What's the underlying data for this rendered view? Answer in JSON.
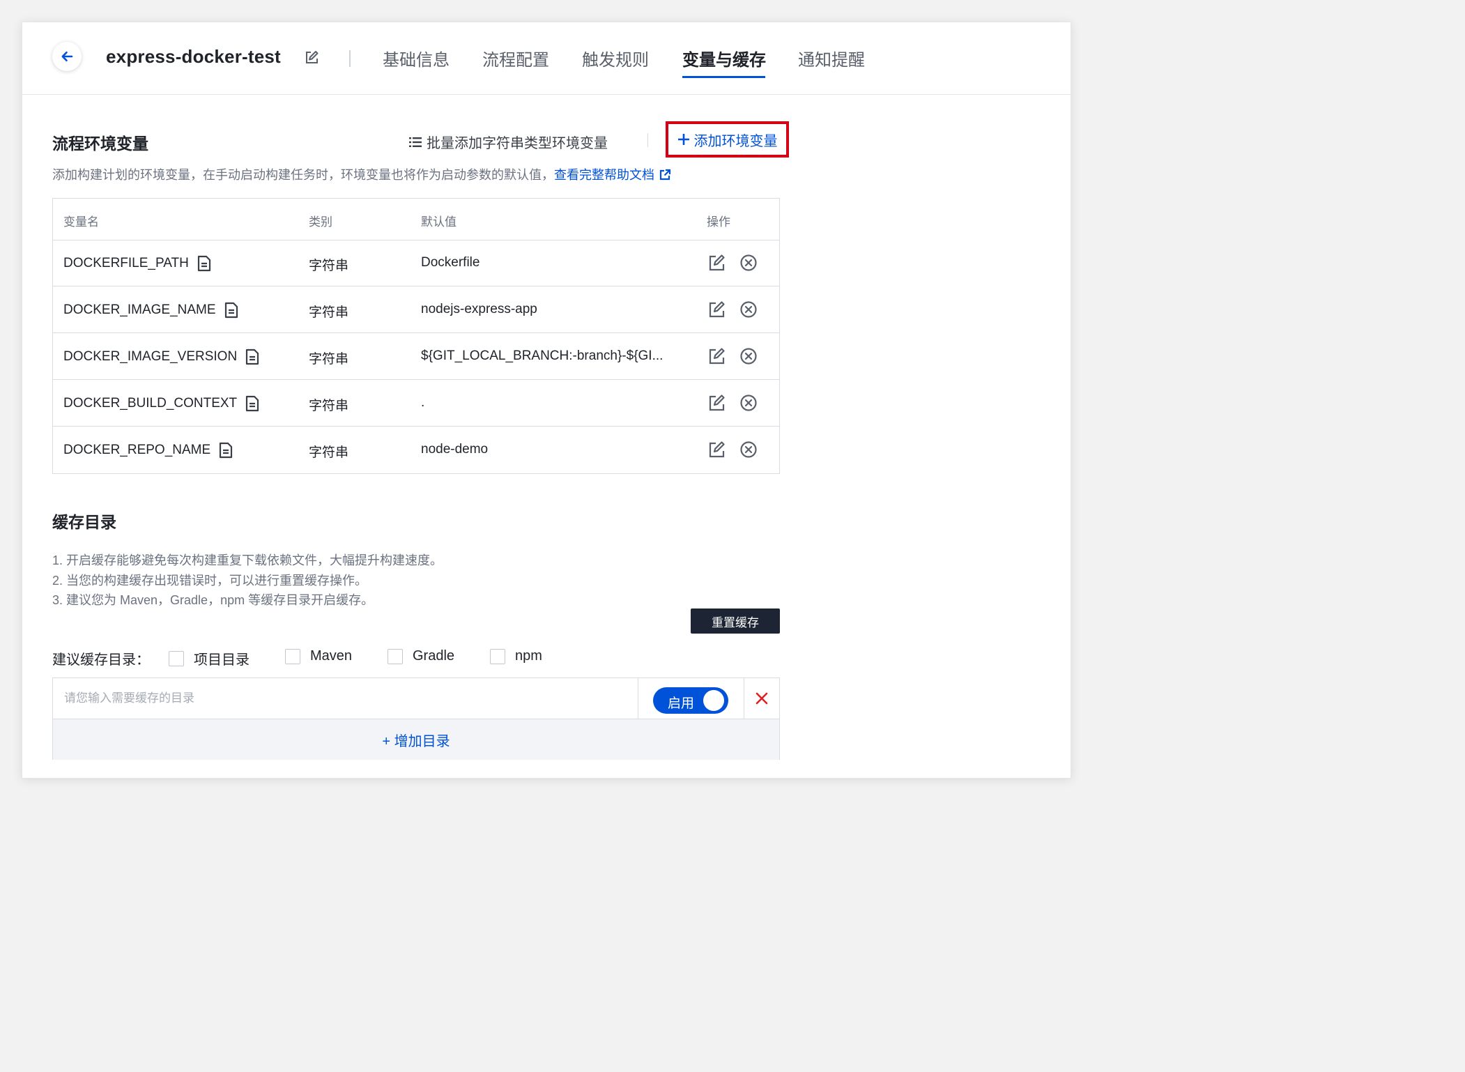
{
  "header": {
    "project_name": "express-docker-test",
    "tabs": [
      {
        "label": "基础信息",
        "active": false
      },
      {
        "label": "流程配置",
        "active": false
      },
      {
        "label": "触发规则",
        "active": false
      },
      {
        "label": "变量与缓存",
        "active": true
      },
      {
        "label": "通知提醒",
        "active": false
      }
    ]
  },
  "env_section": {
    "title": "流程环境变量",
    "batch_add_label": "批量添加字符串类型环境变量",
    "add_label": "添加环境变量",
    "description": "添加构建计划的环境变量，在手动启动构建任务时，环境变量也将作为启动参数的默认值，",
    "help_link": "查看完整帮助文档",
    "columns": [
      "变量名",
      "类别",
      "默认值",
      "操作"
    ],
    "rows": [
      {
        "name": "DOCKERFILE_PATH",
        "type": "字符串",
        "value": "Dockerfile"
      },
      {
        "name": "DOCKER_IMAGE_NAME",
        "type": "字符串",
        "value": "nodejs-express-app"
      },
      {
        "name": "DOCKER_IMAGE_VERSION",
        "type": "字符串",
        "value": "${GIT_LOCAL_BRANCH:-branch}-${GI..."
      },
      {
        "name": "DOCKER_BUILD_CONTEXT",
        "type": "字符串",
        "value": "."
      },
      {
        "name": "DOCKER_REPO_NAME",
        "type": "字符串",
        "value": "node-demo"
      }
    ]
  },
  "cache_section": {
    "title": "缓存目录",
    "notes": [
      "1. 开启缓存能够避免每次构建重复下载依赖文件，大幅提升构建速度。",
      "2. 当您的构建缓存出现错误时，可以进行重置缓存操作。",
      "3. 建议您为 Maven，Gradle，npm 等缓存目录开启缓存。"
    ],
    "reset_label": "重置缓存",
    "suggest_label": "建议缓存目录：",
    "suggest_options": [
      {
        "label": "项目目录",
        "checked": false
      },
      {
        "label": "Maven",
        "checked": false
      },
      {
        "label": "Gradle",
        "checked": false
      },
      {
        "label": "npm",
        "checked": false
      }
    ],
    "dir_placeholder": "请您输入需要缓存的目录",
    "dir_value": "",
    "toggle_label": "启用",
    "toggle_on": true,
    "add_dir_label": "+ 增加目录"
  },
  "colors": {
    "accent": "#0052d9",
    "highlight_border": "#d40016",
    "delete_x": "#e02020",
    "dark_button": "#1d2433"
  },
  "icons": {
    "back": "arrow-left-icon",
    "edit_name": "edit-icon",
    "list": "list-icon",
    "plus": "plus-icon",
    "external_link": "external-link-icon",
    "variable_doc": "document-icon",
    "row_edit": "edit-icon",
    "row_delete": "circle-x-icon",
    "remove_dir": "close-icon"
  }
}
